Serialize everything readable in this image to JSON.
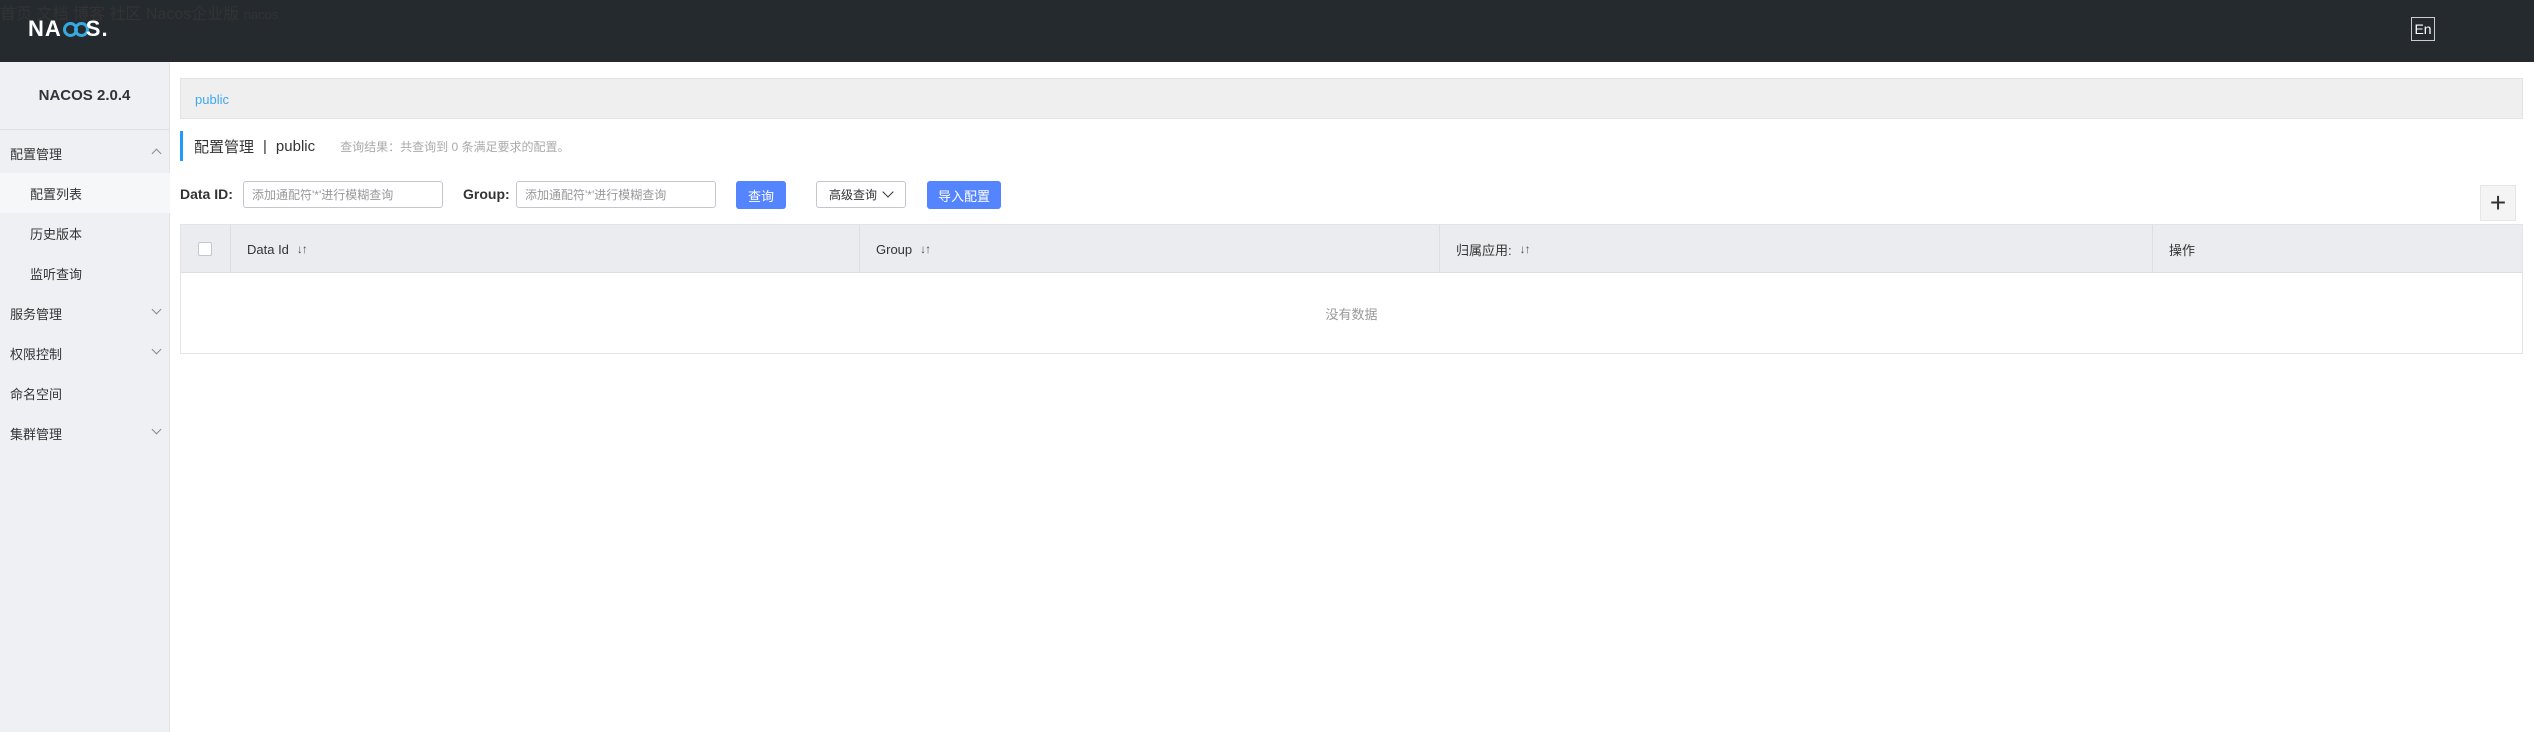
{
  "header": {
    "logo_text_prefix": "NA",
    "logo_text_suffix": "S",
    "logo_dot": ".",
    "nav": [
      {
        "label": "首页"
      },
      {
        "label": "文档"
      },
      {
        "label": "博客"
      },
      {
        "label": "社区"
      },
      {
        "label": "Nacos企业版"
      }
    ],
    "lang_button": "En",
    "user": "nacos"
  },
  "sidebar": {
    "title": "NACOS 2.0.4",
    "items": [
      {
        "label": "配置管理"
      },
      {
        "label": "配置列表"
      },
      {
        "label": "历史版本"
      },
      {
        "label": "监听查询"
      },
      {
        "label": "服务管理"
      },
      {
        "label": "权限控制"
      },
      {
        "label": "命名空间"
      },
      {
        "label": "集群管理"
      }
    ]
  },
  "breadcrumb": {
    "namespace": "public"
  },
  "title": {
    "main": "配置管理",
    "separator": "|",
    "namespace": "public",
    "result_text": "查询结果：共查询到 0 条满足要求的配置。"
  },
  "search": {
    "data_id_label": "Data ID:",
    "data_id_placeholder": "添加通配符'*'进行模糊查询",
    "group_label": "Group:",
    "group_placeholder": "添加通配符'*'进行模糊查询",
    "query_button": "查询",
    "advanced_query": "高级查询",
    "import_button": "导入配置",
    "add_button": "+"
  },
  "table": {
    "columns": [
      {
        "label": "Data Id",
        "sortable": true
      },
      {
        "label": "Group",
        "sortable": true
      },
      {
        "label": "归属应用:",
        "sortable": true
      },
      {
        "label": "操作",
        "sortable": false
      }
    ],
    "sort_glyph": "↓↑",
    "empty_text": "没有数据"
  },
  "colors": {
    "topbar": "#252a2f",
    "primary": "#5584ff",
    "accent_link": "#3fa7f0",
    "sidebar_bg": "#eef0f4"
  }
}
